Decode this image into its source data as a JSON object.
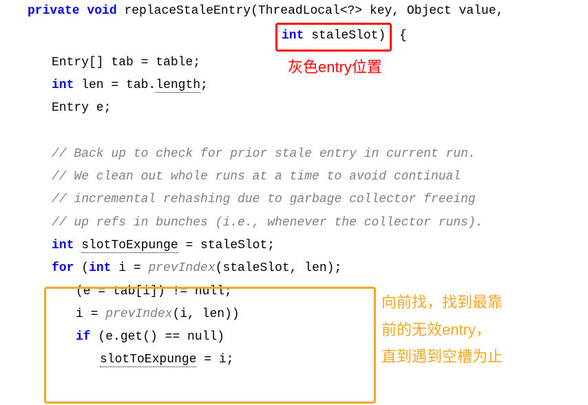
{
  "code": {
    "line1": {
      "kw1": "private void",
      "method": "replaceStaleEntry(ThreadLocal<?> key, Object value,"
    },
    "line2": {
      "type": "int",
      "param": "staleSlot)",
      "brace": " {"
    },
    "line3": {
      "a": "Entry[] tab = table;"
    },
    "line4": {
      "type": "int",
      "rest": " len = tab.",
      "len": "length",
      "semi": ";"
    },
    "line5": {
      "a": "Entry e;"
    },
    "comment1": "// Back up to check for prior stale entry in current run.",
    "comment2": "// We clean out whole runs at a time to avoid continual",
    "comment3": "// incremental rehashing due to garbage collector freeing",
    "comment4": "// up refs in bunches (i.e., whenever the collector runs).",
    "line10": {
      "type": "int",
      "rest1": " ",
      "var": "slotToExpunge",
      "rest2": " = staleSlot;"
    },
    "line11": {
      "kw": "for",
      "paren": " (",
      "type": "int",
      "rest1": " i = ",
      "fn": "prevIndex",
      "rest2": "(staleSlot, len);"
    },
    "line12": "(e = tab[i]) != null;",
    "line13": {
      "rest1": "i = ",
      "fn": "prevIndex",
      "rest2": "(i, len))"
    },
    "line14": {
      "kw": "if",
      "rest": " (e.get() == null)"
    },
    "line15": {
      "var": "slotToExpunge",
      "rest": " = i;"
    }
  },
  "annotations": {
    "red": "灰色entry位置",
    "orange1": "向前找，找到最靠",
    "orange2": "前的无效entry，",
    "orange3": "直到遇到空槽为止"
  }
}
